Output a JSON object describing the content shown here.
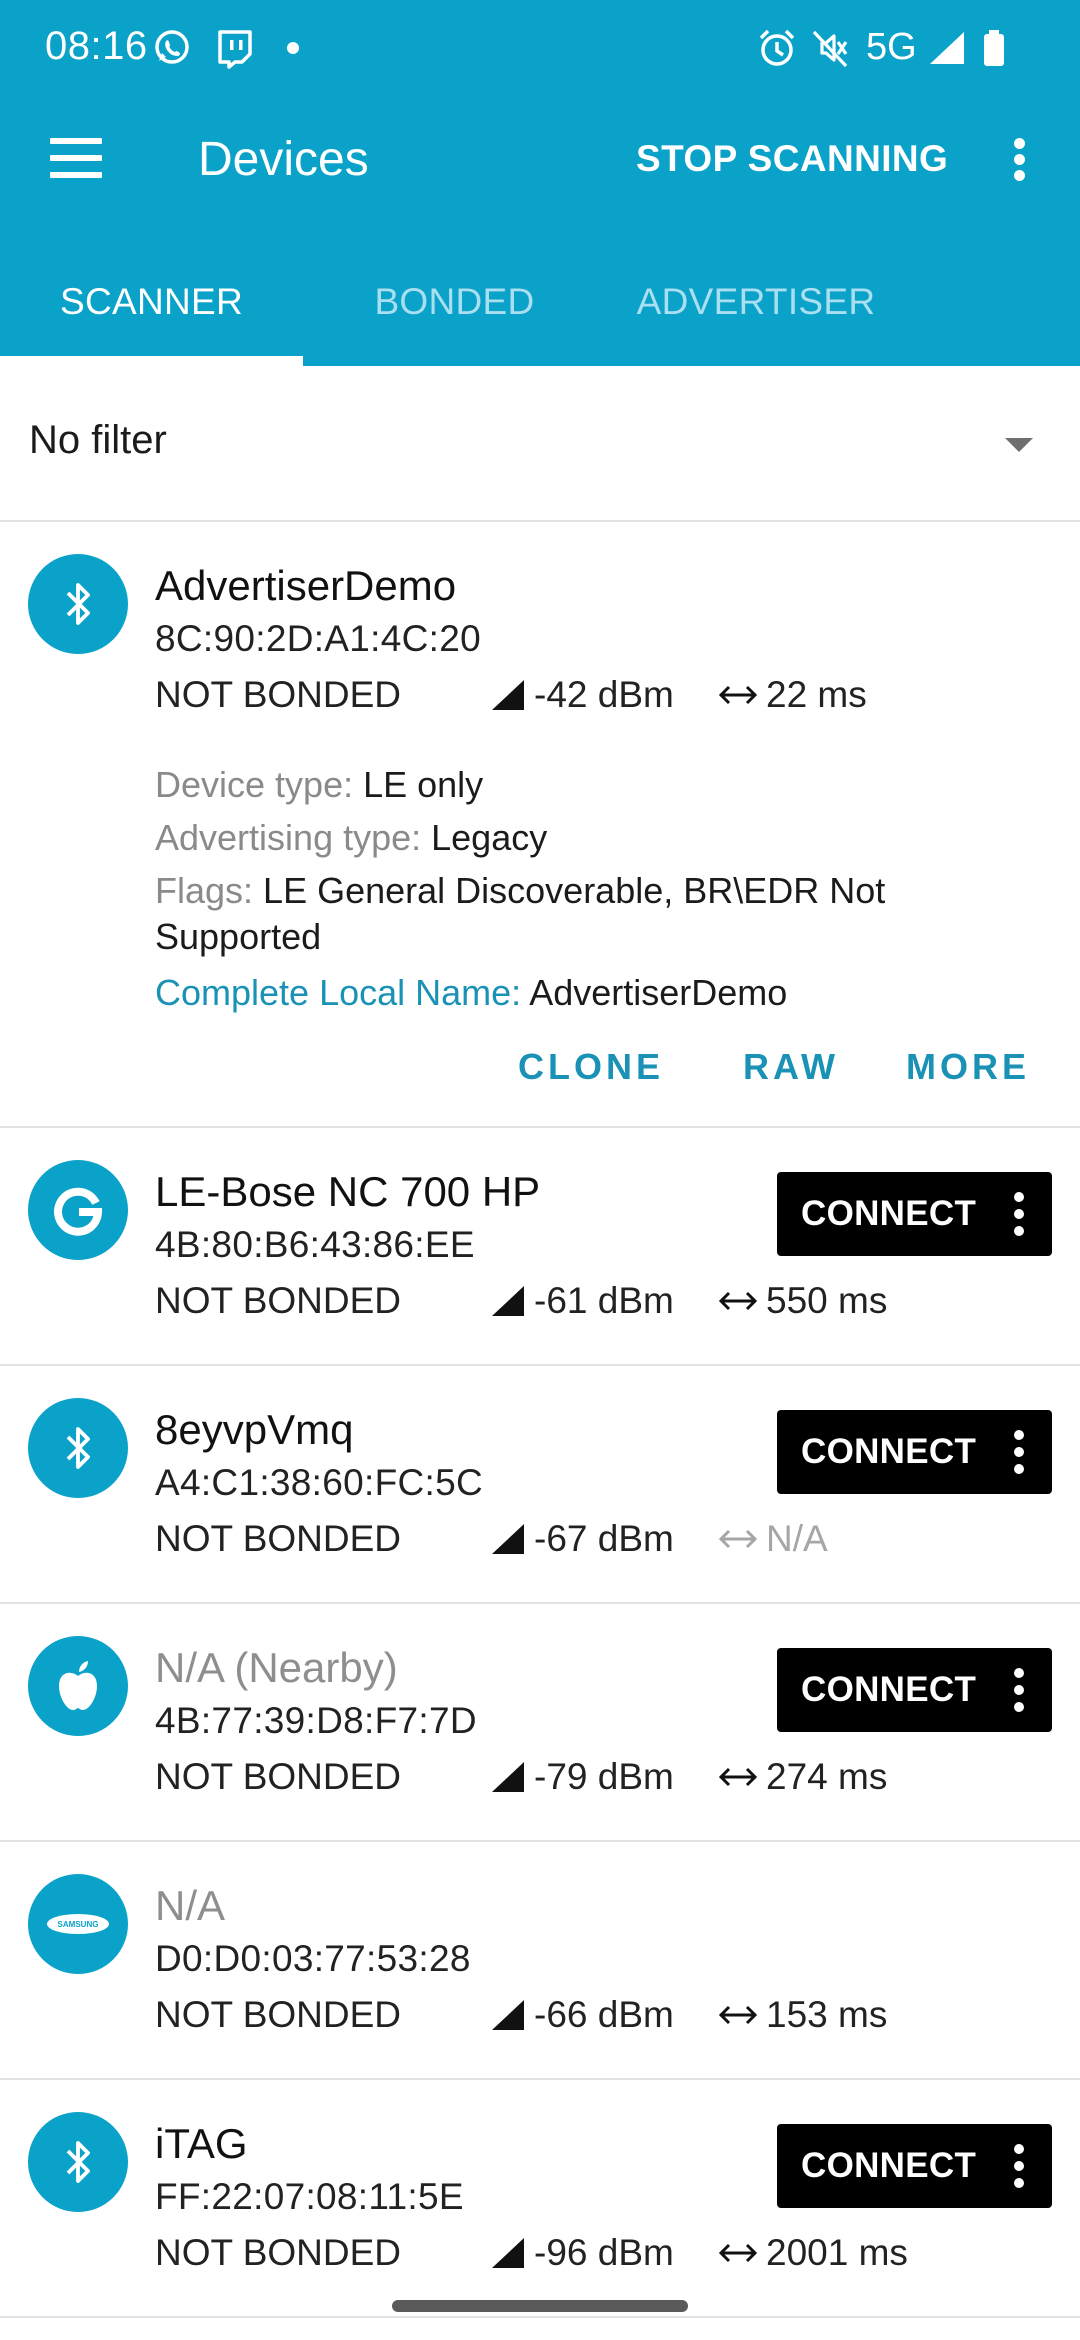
{
  "status_bar": {
    "time": "08:16",
    "network": "5G",
    "icons": [
      "whatsapp-icon",
      "twitch-icon",
      "notification-dot",
      "alarm-icon",
      "vibrate-off-icon",
      "signal-icon",
      "battery-icon"
    ]
  },
  "toolbar": {
    "title": "Devices",
    "action_label": "STOP SCANNING",
    "menu_icon": "hamburger-menu-icon",
    "overflow_icon": "more-vert-icon"
  },
  "tabs": [
    {
      "label": "SCANNER",
      "active": true
    },
    {
      "label": "BONDED",
      "active": false
    },
    {
      "label": "ADVERTISER",
      "active": false
    }
  ],
  "filter": {
    "label": "No filter",
    "icon": "dropdown-arrow-icon"
  },
  "colors": {
    "primary": "#0aa2c9",
    "tab_inactive": "#a9dff0",
    "link": "#1a92b5",
    "connect_button": "#000000",
    "muted_text": "#8e8e8e"
  },
  "devices": [
    {
      "name": "AdvertiserDemo",
      "address": "8C:90:2D:A1:4C:20",
      "bond_state": "NOT BONDED",
      "rssi": "-42 dBm",
      "interval": "22 ms",
      "icon": "bluetooth-icon",
      "expanded": true,
      "details": {
        "device_type_label": "Device type: ",
        "device_type": "LE only",
        "advertising_type_label": "Advertising type: ",
        "advertising_type": "Legacy",
        "flags_label": "Flags: ",
        "flags": "LE General Discoverable, BR\\EDR Not Supported",
        "local_name_label": "Complete Local Name: ",
        "local_name": "AdvertiserDemo"
      },
      "actions": [
        "CLONE",
        "RAW",
        "MORE"
      ]
    },
    {
      "name": "LE-Bose NC 700 HP",
      "address": "4B:80:B6:43:86:EE",
      "bond_state": "NOT BONDED",
      "rssi": "-61 dBm",
      "interval": "550 ms",
      "icon": "google-icon",
      "connect_label": "CONNECT"
    },
    {
      "name": "8eyvpVmq",
      "address": "A4:C1:38:60:FC:5C",
      "bond_state": "NOT BONDED",
      "rssi": "-67 dBm",
      "interval": "N/A",
      "icon": "bluetooth-icon",
      "connect_label": "CONNECT"
    },
    {
      "name": "N/A  (Nearby)",
      "address": "4B:77:39:D8:F7:7D",
      "bond_state": "NOT BONDED",
      "rssi": "-79 dBm",
      "interval": "274 ms",
      "icon": "apple-icon",
      "connect_label": "CONNECT"
    },
    {
      "name": "N/A",
      "address": "D0:D0:03:77:53:28",
      "bond_state": "NOT BONDED",
      "rssi": "-66 dBm",
      "interval": "153 ms",
      "icon": "samsung-icon",
      "logo_text": "SAMSUNG"
    },
    {
      "name": "iTAG",
      "address": "FF:22:07:08:11:5E",
      "bond_state": "NOT BONDED",
      "rssi": "-96 dBm",
      "interval": "2001 ms",
      "icon": "bluetooth-icon",
      "connect_label": "CONNECT"
    }
  ]
}
